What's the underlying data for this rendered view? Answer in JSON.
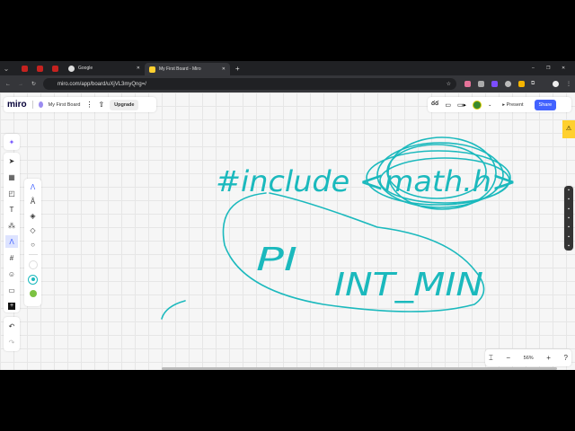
{
  "browser": {
    "tabs": [
      {
        "label": "Google",
        "icon": "google-icon"
      },
      {
        "label": "My First Board - Miro",
        "icon": "miro-icon",
        "active": true
      }
    ],
    "url": "miro.com/app/board/uXjVL3myQng=/"
  },
  "miro": {
    "logo": "miro",
    "board_name": "My First Board",
    "upgrade_label": "Upgrade",
    "present_label": "Present",
    "share_label": "Share",
    "zoom_level": "56%",
    "accent": "#4262ff"
  },
  "drawing": {
    "ink_color": "#1bb9bd",
    "text_strokes": [
      "#include <math.h>",
      "PI",
      "INT_MIN"
    ]
  }
}
